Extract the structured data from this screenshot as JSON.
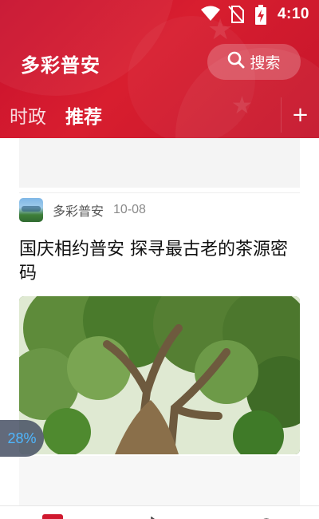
{
  "status_bar": {
    "time": "4:10"
  },
  "app": {
    "title": "多彩普安",
    "search_label": "搜索"
  },
  "tabs": [
    {
      "label": "时政",
      "active": false
    },
    {
      "label": "推荐",
      "active": true
    }
  ],
  "add_tab_label": "+",
  "feed": {
    "article": {
      "source": "多彩普安",
      "date": "10-08",
      "title": "国庆相约普安 探寻最古老的茶源密码"
    }
  },
  "progress_badge": "28%",
  "colors": {
    "brand": "#d81e2f",
    "accent_blue": "#4fb7ff"
  }
}
